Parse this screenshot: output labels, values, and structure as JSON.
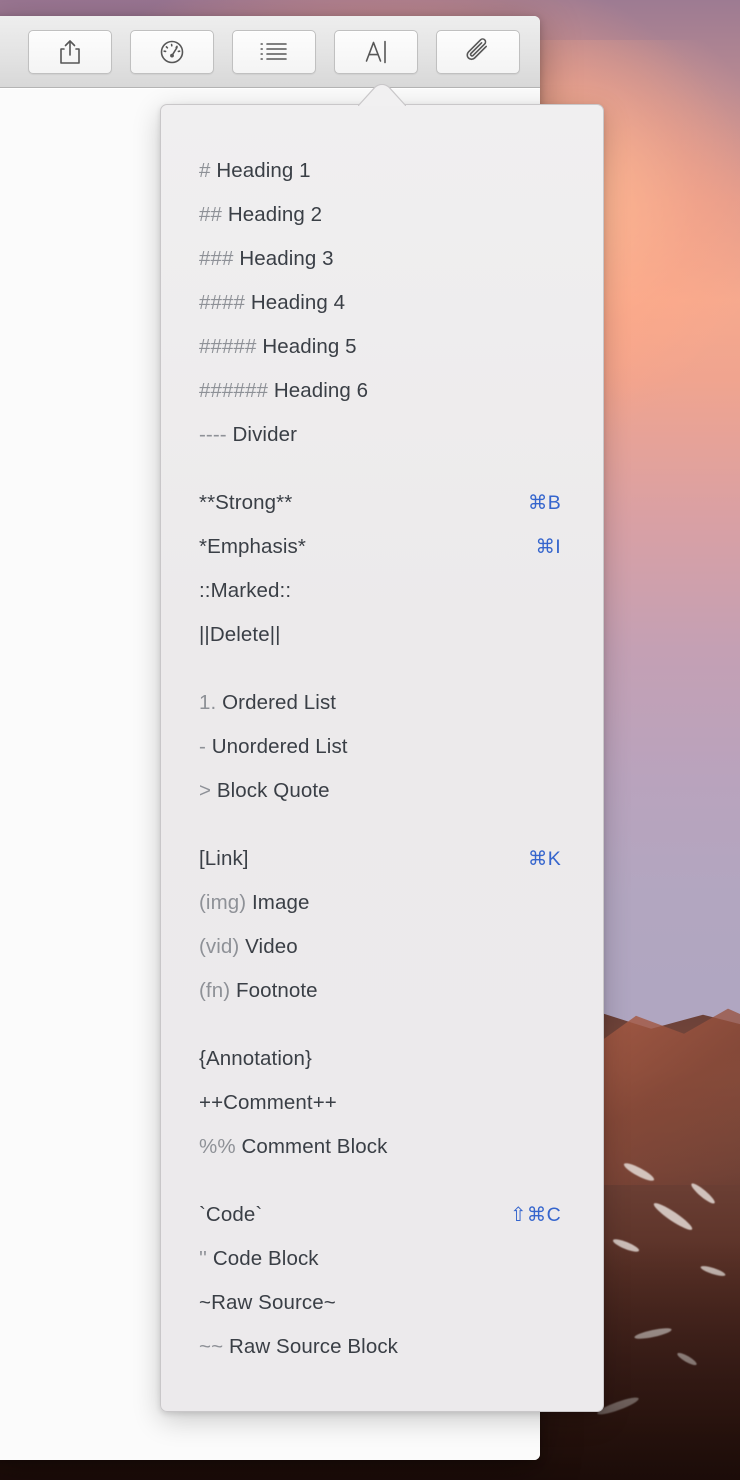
{
  "window": {
    "toolbar": {
      "buttons": [
        {
          "name": "share-button",
          "icon": "share-icon",
          "label": "Share"
        },
        {
          "name": "gauge-button",
          "icon": "gauge-icon",
          "label": "Statistics"
        },
        {
          "name": "outline-button",
          "icon": "list-icon",
          "label": "Outline"
        },
        {
          "name": "format-button",
          "icon": "text-format-icon",
          "label": "Format"
        },
        {
          "name": "attachment-button",
          "icon": "paperclip-icon",
          "label": "Attachments"
        }
      ]
    }
  },
  "popover": {
    "accent_color": "#3565cd",
    "syntax_color": "#8e9197",
    "label_color": "#3a3f46",
    "groups": [
      {
        "name": "headings-group",
        "items": [
          {
            "syntax": "#",
            "label": "Heading 1",
            "shortcut": ""
          },
          {
            "syntax": "##",
            "label": "Heading 2",
            "shortcut": ""
          },
          {
            "syntax": "###",
            "label": "Heading 3",
            "shortcut": ""
          },
          {
            "syntax": "####",
            "label": "Heading 4",
            "shortcut": ""
          },
          {
            "syntax": "#####",
            "label": "Heading 5",
            "shortcut": ""
          },
          {
            "syntax": "######",
            "label": "Heading 6",
            "shortcut": ""
          },
          {
            "syntax": "----",
            "label": "Divider",
            "shortcut": ""
          }
        ]
      },
      {
        "name": "inline-style-group",
        "items": [
          {
            "syntax": "",
            "label": "**Strong**",
            "shortcut": "⌘B"
          },
          {
            "syntax": "",
            "label": "*Emphasis*",
            "shortcut": "⌘I"
          },
          {
            "syntax": "",
            "label": "::Marked::",
            "shortcut": ""
          },
          {
            "syntax": "",
            "label": "||Delete||",
            "shortcut": ""
          }
        ]
      },
      {
        "name": "list-group",
        "items": [
          {
            "syntax": "1.",
            "label": "Ordered List",
            "shortcut": ""
          },
          {
            "syntax": "-",
            "label": "Unordered List",
            "shortcut": ""
          },
          {
            "syntax": ">",
            "label": "Block Quote",
            "shortcut": ""
          }
        ]
      },
      {
        "name": "media-group",
        "items": [
          {
            "syntax": "",
            "label": "[Link]",
            "shortcut": "⌘K"
          },
          {
            "syntax": "(img)",
            "label": "Image",
            "shortcut": ""
          },
          {
            "syntax": "(vid)",
            "label": "Video",
            "shortcut": ""
          },
          {
            "syntax": "(fn)",
            "label": "Footnote",
            "shortcut": ""
          }
        ]
      },
      {
        "name": "annotation-group",
        "items": [
          {
            "syntax": "",
            "label": "{Annotation}",
            "shortcut": ""
          },
          {
            "syntax": "",
            "label": "++Comment++",
            "shortcut": ""
          },
          {
            "syntax": "%%",
            "label": "Comment Block",
            "shortcut": ""
          }
        ]
      },
      {
        "name": "code-group",
        "items": [
          {
            "syntax": "",
            "label": "`Code`",
            "shortcut": "⇧⌘C"
          },
          {
            "syntax": "''",
            "label": "Code Block",
            "shortcut": ""
          },
          {
            "syntax": "",
            "label": "~Raw Source~",
            "shortcut": ""
          },
          {
            "syntax": "~~",
            "label": "Raw Source Block",
            "shortcut": ""
          }
        ]
      }
    ]
  }
}
